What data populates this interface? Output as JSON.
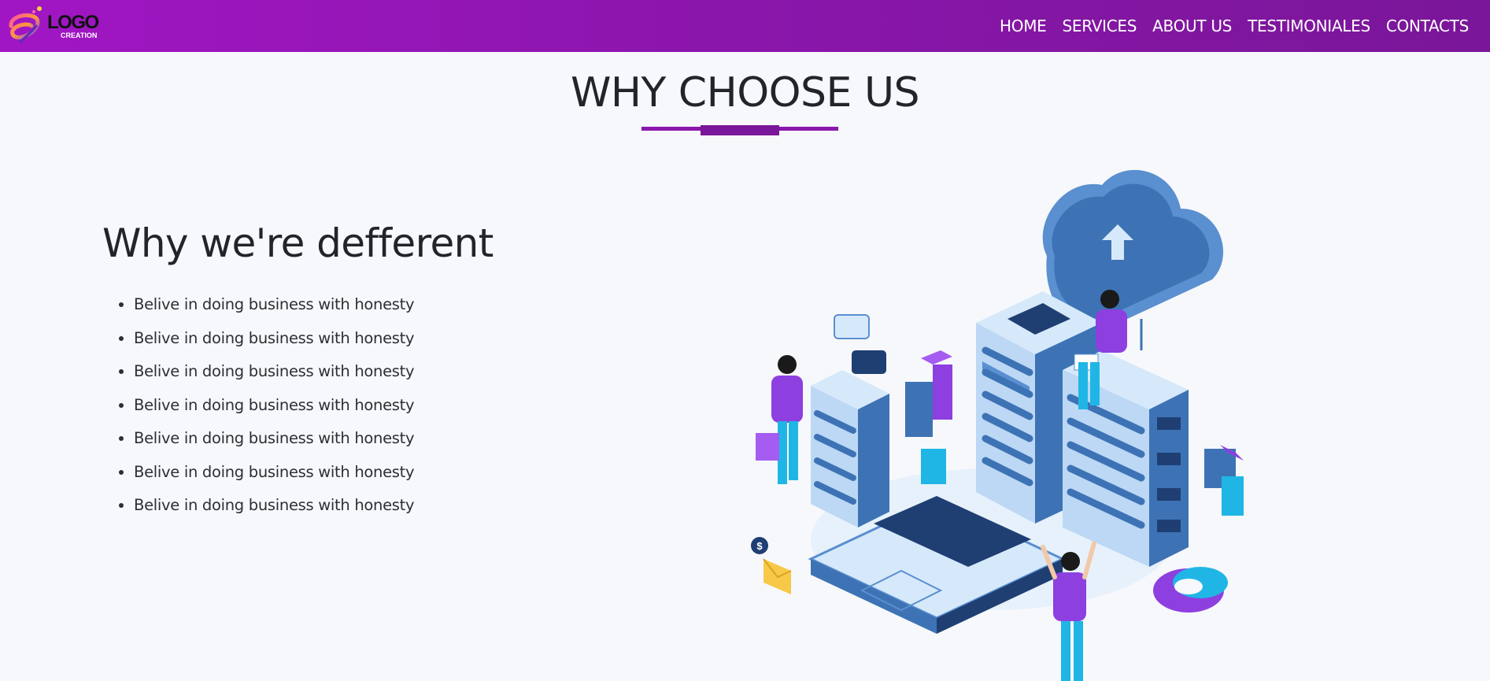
{
  "brand": {
    "logo_text": "LOGO",
    "logo_subtext": "CREATION"
  },
  "nav": {
    "items": [
      {
        "label": "HOME"
      },
      {
        "label": "SERVICES"
      },
      {
        "label": "ABOUT US"
      },
      {
        "label": "TESTIMONIALES"
      },
      {
        "label": "CONTACTS"
      }
    ]
  },
  "section": {
    "title": "WHY CHOOSE US",
    "subtitle": "Why we're defferent",
    "points": [
      "Belive in doing business with honesty",
      "Belive in doing business with honesty",
      "Belive in doing business with honesty",
      "Belive in doing business with honesty",
      "Belive in doing business with honesty",
      "Belive in doing business with honesty",
      "Belive in doing business with honesty"
    ]
  },
  "illustration": {
    "icon": "cloud-server-isometric-illustration",
    "badge_text": "$"
  },
  "colors": {
    "nav_gradient_start": "#a116c4",
    "nav_gradient_end": "#7a1699",
    "accent": "#8a18ac",
    "background": "#f7f8fb",
    "illustration_blue": "#3d73b5",
    "illustration_light": "#d6e9fb",
    "illustration_purple": "#8d3fe0",
    "illustration_cyan": "#1fb6e6"
  }
}
